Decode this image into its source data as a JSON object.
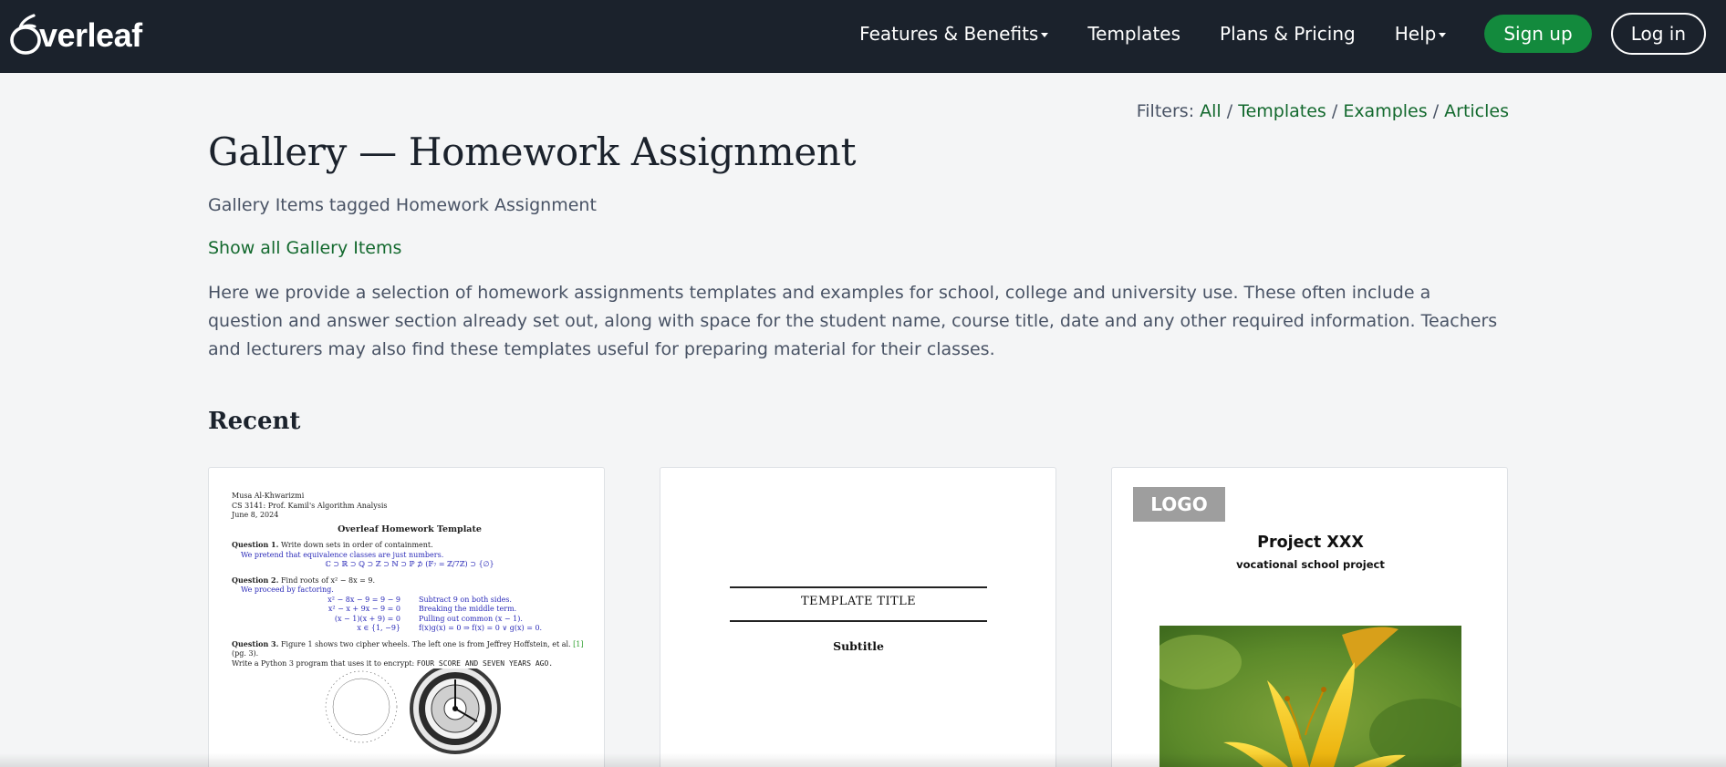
{
  "navbar": {
    "logo_text": "verleaf",
    "items": [
      {
        "label": "Features & Benefits",
        "dropdown": true
      },
      {
        "label": "Templates",
        "dropdown": false
      },
      {
        "label": "Plans & Pricing",
        "dropdown": false
      },
      {
        "label": "Help",
        "dropdown": true
      }
    ],
    "signup_label": "Sign up",
    "login_label": "Log in"
  },
  "filters": {
    "label": "Filters:",
    "links": [
      "All",
      "Templates",
      "Examples",
      "Articles"
    ],
    "separator": "/"
  },
  "page": {
    "title": "Gallery — Homework Assignment",
    "subtitle": "Gallery Items tagged Homework Assignment",
    "show_all": "Show all Gallery Items",
    "description": "Here we provide a selection of homework assignments templates and examples for school, college and university use. These often include a question and answer section already set out, along with space for the student name, course title, date and any other required information. Teachers and lecturers may also find these templates useful for preparing material for their classes."
  },
  "section": {
    "title": "Recent"
  },
  "cards": [
    {
      "preview": {
        "author": "Musa Al-Khwarizmi",
        "course": "CS 3141: Prof. Kamil's Algorithm Analysis",
        "date": "June 8, 2024",
        "doc_title": "Overleaf Homework Template",
        "q1_label": "Question 1.",
        "q1_text": "Write down sets in order of containment.",
        "q1_answer": "We pretend that equivalence classes are just numbers.",
        "q1_math": "ℂ ⊃ ℝ ⊃ ℚ ⊃ ℤ ⊃ ℕ ⊃ ℙ ⊅ (𝔽₇ = ℤ/7ℤ) ⊃ {∅}",
        "q2_label": "Question 2.",
        "q2_text": "Find roots of x² − 8x = 9.",
        "q2_answer": "We proceed by factoring.",
        "steps": [
          {
            "lhs": "x² − 8x − 9 = 9 − 9",
            "rhs": "Subtract 9 on both sides."
          },
          {
            "lhs": "x² − x + 9x − 9 = 0",
            "rhs": "Breaking the middle term."
          },
          {
            "lhs": "(x − 1)(x + 9) = 0",
            "rhs": "Pulling out common (x − 1)."
          },
          {
            "lhs": "x ∈ {1, −9}",
            "rhs": "f(x)g(x) = 0 ⇒ f(x) = 0 ∨ g(x) = 0."
          }
        ],
        "q3_label": "Question 3.",
        "q3_text_a": "Figure 1 shows two cipher wheels. The left one is from Jeffrey Hoffstein, et al.",
        "q3_ref": "[1]",
        "q3_text_b": "(pg. 3).",
        "q3_text_c": "Write a Python 3 program that uses it to encrypt:",
        "q3_mono": "FOUR SCORE AND SEVEN YEARS AGO."
      }
    },
    {
      "preview": {
        "title": "TEMPLATE TITLE",
        "subtitle": "Subtitle"
      }
    },
    {
      "preview": {
        "logo": "LOGO",
        "title": "Project XXX",
        "subtitle": "vocational school project"
      }
    }
  ],
  "colors": {
    "navbar_bg": "#1b222c",
    "brand_green": "#138a3d",
    "link_green": "#13692e",
    "page_bg": "#f4f5f6"
  },
  "icons": {
    "logo": "overleaf-leaf-icon",
    "dropdown": "caret-down-icon"
  }
}
